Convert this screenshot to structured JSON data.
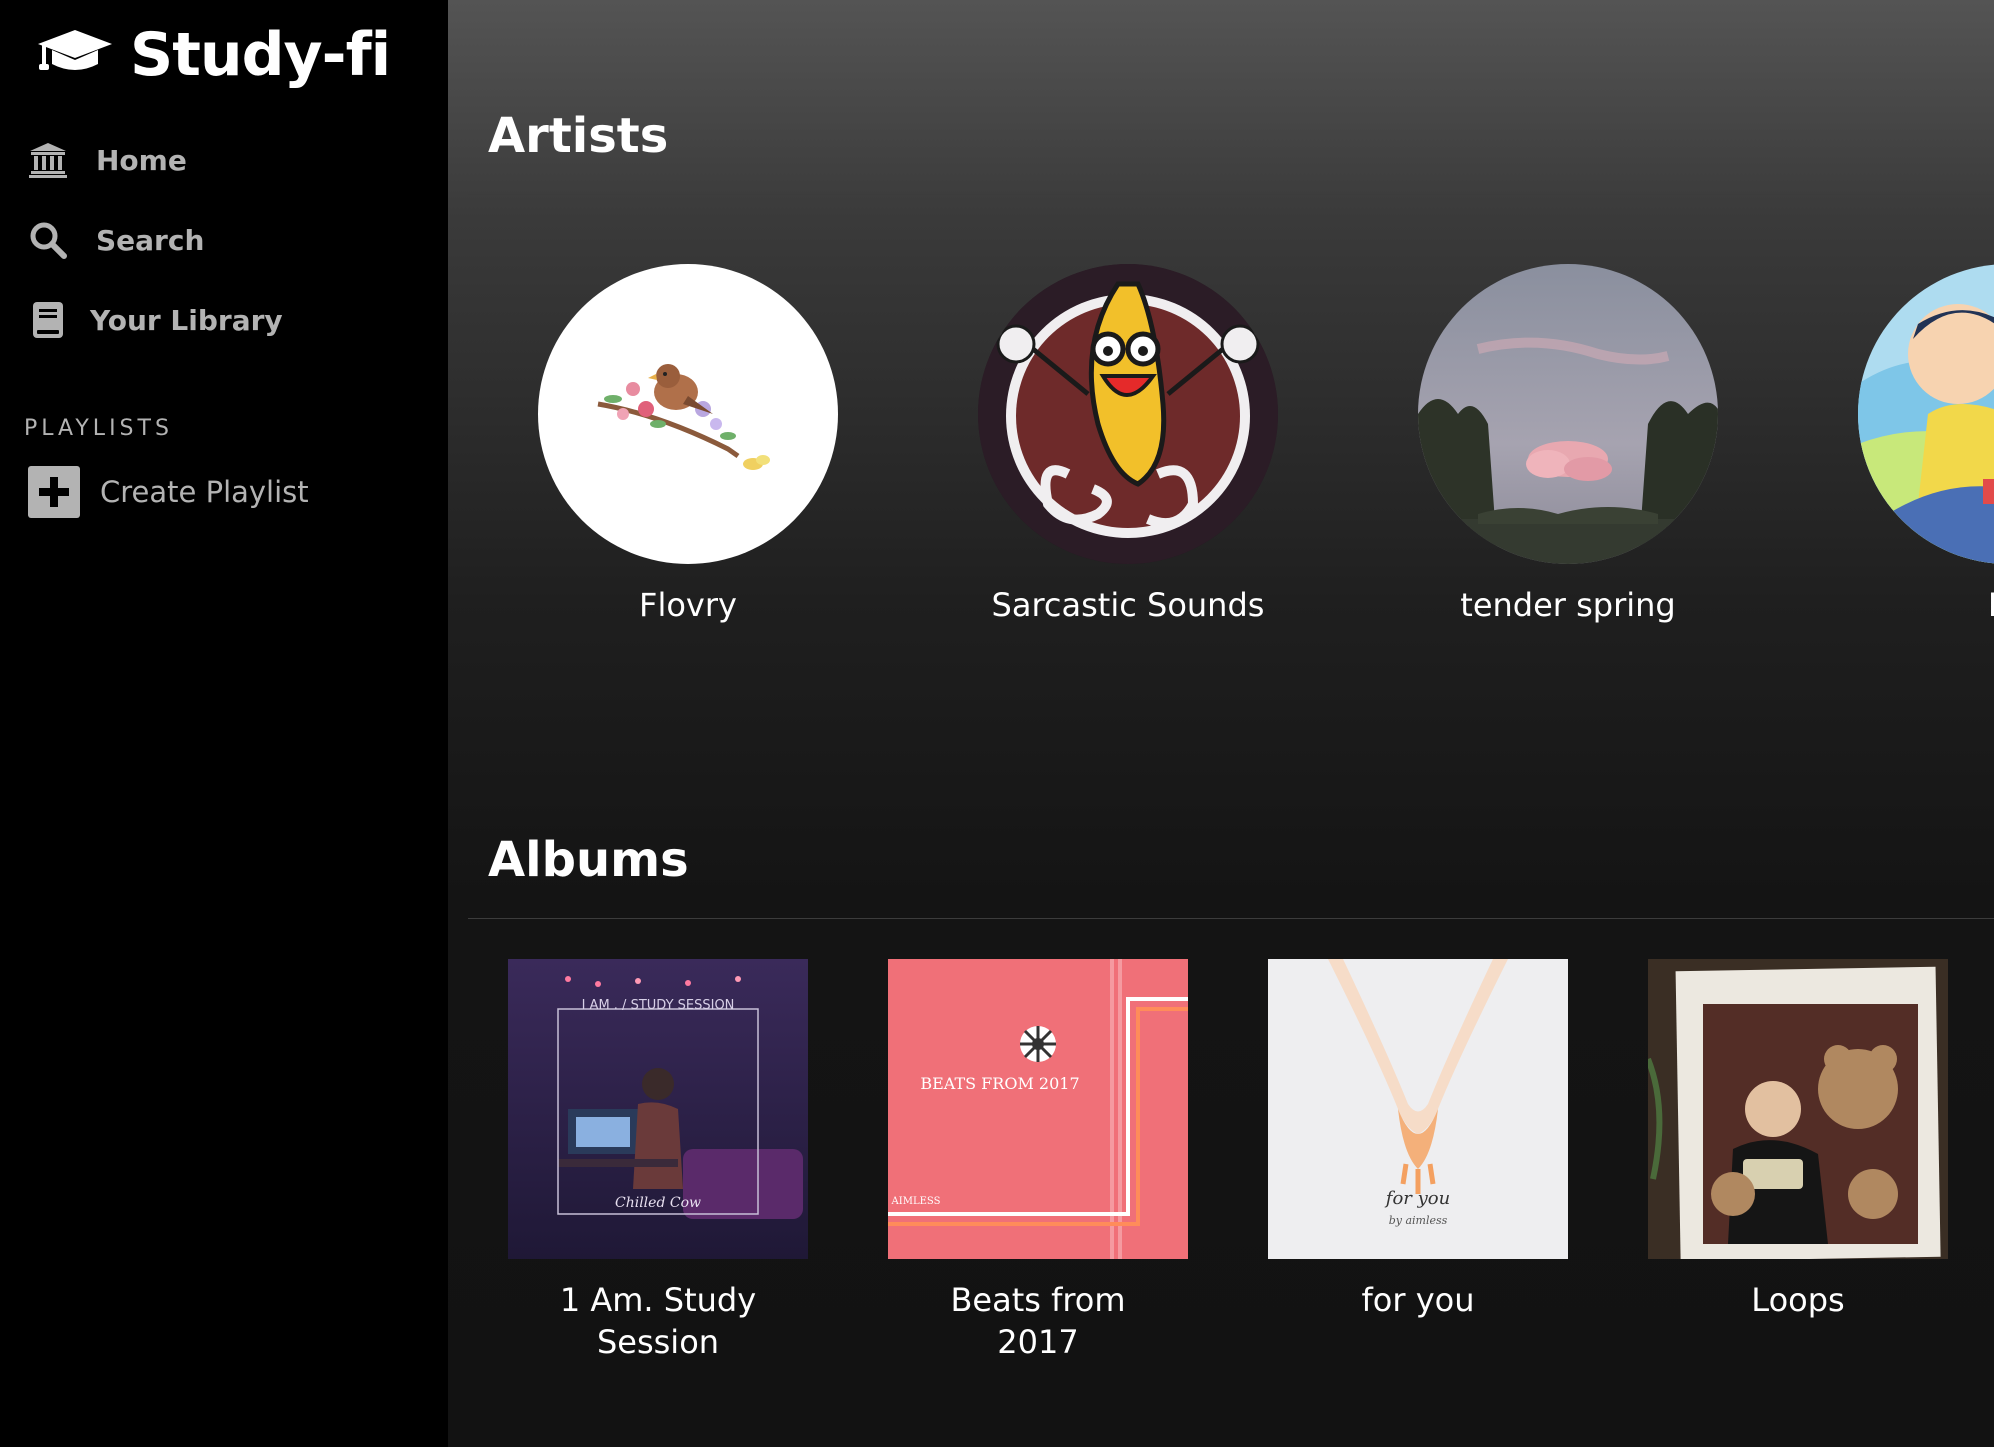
{
  "app": {
    "name": "Study-fi",
    "logo_icon": "graduation-cap-icon"
  },
  "sidebar": {
    "nav": [
      {
        "label": "Home",
        "icon": "bank-icon"
      },
      {
        "label": "Search",
        "icon": "search-icon"
      },
      {
        "label": "Your Library",
        "icon": "book-icon"
      }
    ],
    "playlists_heading": "PLAYLISTS",
    "create_playlist": {
      "label": "Create Playlist",
      "icon": "plus-icon"
    }
  },
  "artists": {
    "title": "Artists",
    "items": [
      {
        "name": "Flovry"
      },
      {
        "name": "Sarcastic Sounds"
      },
      {
        "name": "tender spring"
      },
      {
        "name": "Ro"
      }
    ]
  },
  "albums": {
    "title": "Albums",
    "items": [
      {
        "title": "1 Am. Study Session",
        "cover_text": [
          "I AM . / STUDY SESSION",
          "Chilled Cow"
        ]
      },
      {
        "title": "Beats from 2017",
        "cover_text": [
          "BEATS FROM 2017",
          "AIMLESS"
        ]
      },
      {
        "title": "for you",
        "cover_text": [
          "for you",
          "by aimless"
        ]
      },
      {
        "title": "Loops"
      }
    ]
  },
  "colors": {
    "sidebar_bg": "#000000",
    "main_bg": "#121212",
    "text_primary": "#ffffff",
    "text_secondary": "#b3b3b3"
  }
}
